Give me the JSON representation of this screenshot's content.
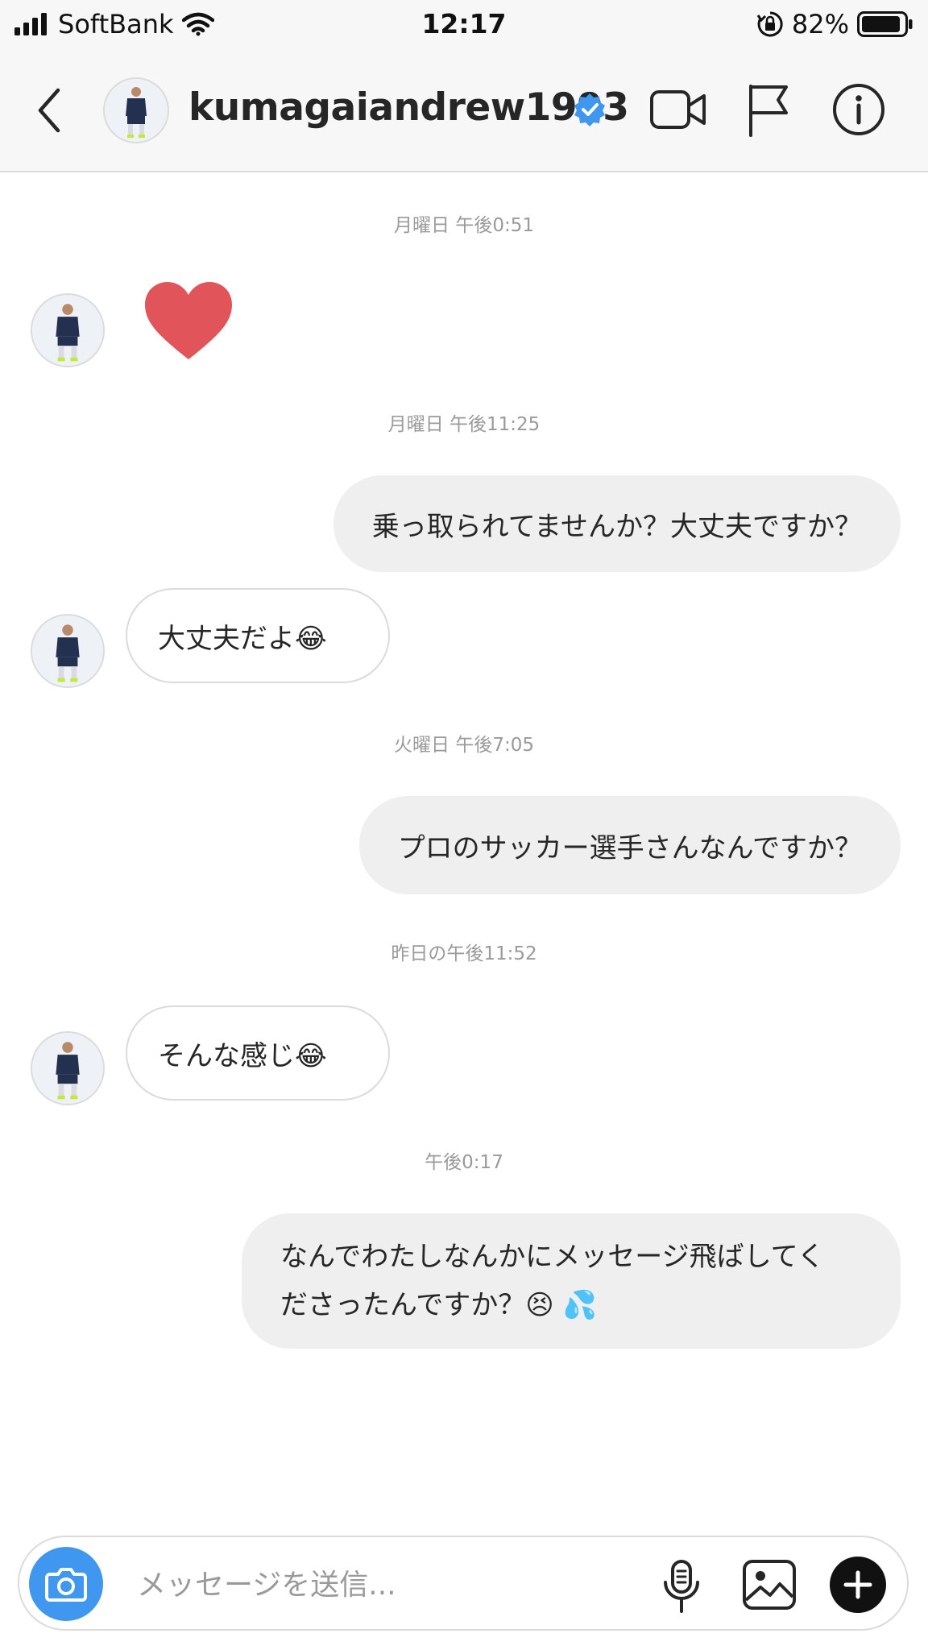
{
  "status_bar": {
    "carrier": "SoftBank",
    "time": "12:17",
    "battery": "82%"
  },
  "header": {
    "username": "kumagaiandrew1993",
    "icons": [
      "back-arrow-icon",
      "verified-badge-icon",
      "video-call-icon",
      "flag-icon",
      "info-icon"
    ]
  },
  "thread": {
    "timestamps": [
      "月曜日 午後0:51",
      "月曜日 午後11:25",
      "火曜日 午後7:05",
      "昨日の午後11:52",
      "午後0:17"
    ],
    "messages": [
      {
        "from": "them",
        "type": "heart"
      },
      {
        "from": "me",
        "text": "乗っ取られてませんか？大丈夫ですか？"
      },
      {
        "from": "them",
        "text": "大丈夫だよ😂"
      },
      {
        "from": "me",
        "text": "プロのサッカー選手さんなんですか？"
      },
      {
        "from": "them",
        "text": "そんな感じ😂"
      },
      {
        "from": "me",
        "line1": "なんでわたしなんかにメッセージ飛ばしてく",
        "line2": "ださったんですか？😣 💦"
      }
    ]
  },
  "composer": {
    "placeholder": "メッセージを送信...",
    "value": ""
  },
  "colors": {
    "accent": "#3f97f0",
    "heart": "#e0545a",
    "bubble_out": "#efefef",
    "border": "#dbdbdb"
  }
}
